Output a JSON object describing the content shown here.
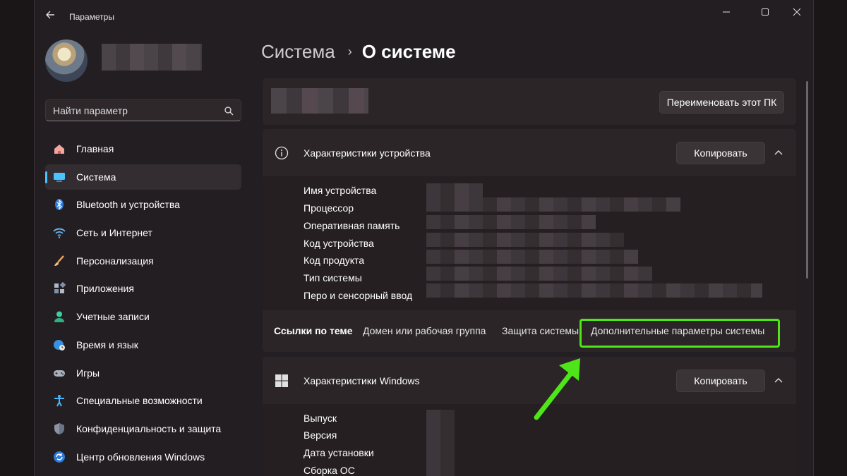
{
  "app": {
    "title": "Параметры"
  },
  "search": {
    "placeholder": "Найти параметр"
  },
  "sidebar": {
    "items": [
      {
        "label": "Главная",
        "icon": "home-icon"
      },
      {
        "label": "Система",
        "icon": "display-icon",
        "active": true
      },
      {
        "label": "Bluetooth и устройства",
        "icon": "bluetooth-icon"
      },
      {
        "label": "Сеть и Интернет",
        "icon": "wifi-icon"
      },
      {
        "label": "Персонализация",
        "icon": "brush-icon"
      },
      {
        "label": "Приложения",
        "icon": "apps-icon"
      },
      {
        "label": "Учетные записи",
        "icon": "user-icon"
      },
      {
        "label": "Время и язык",
        "icon": "globe-clock-icon"
      },
      {
        "label": "Игры",
        "icon": "gamepad-icon"
      },
      {
        "label": "Специальные возможности",
        "icon": "accessibility-icon"
      },
      {
        "label": "Конфиденциальность и защита",
        "icon": "shield-icon"
      },
      {
        "label": "Центр обновления Windows",
        "icon": "update-icon"
      }
    ]
  },
  "breadcrumb": {
    "parent": "Система",
    "separator": "›",
    "current": "О системе"
  },
  "pc_card": {
    "rename_label": "Переименовать этот ПК"
  },
  "device_specs": {
    "title": "Характеристики устройства",
    "copy_label": "Копировать",
    "rows": [
      "Имя устройства",
      "Процессор",
      "Оперативная память",
      "Код устройства",
      "Код продукта",
      "Тип системы",
      "Перо и сенсорный ввод"
    ]
  },
  "related": {
    "label": "Ссылки по теме",
    "links": [
      "Домен или рабочая группа",
      "Защита системы",
      "Дополнительные параметры системы"
    ]
  },
  "windows_specs": {
    "title": "Характеристики Windows",
    "copy_label": "Копировать",
    "rows": [
      "Выпуск",
      "Версия",
      "Дата установки",
      "Сборка ОС"
    ]
  },
  "colors": {
    "accent": "#4cc2ff",
    "highlight": "#4fe619"
  }
}
